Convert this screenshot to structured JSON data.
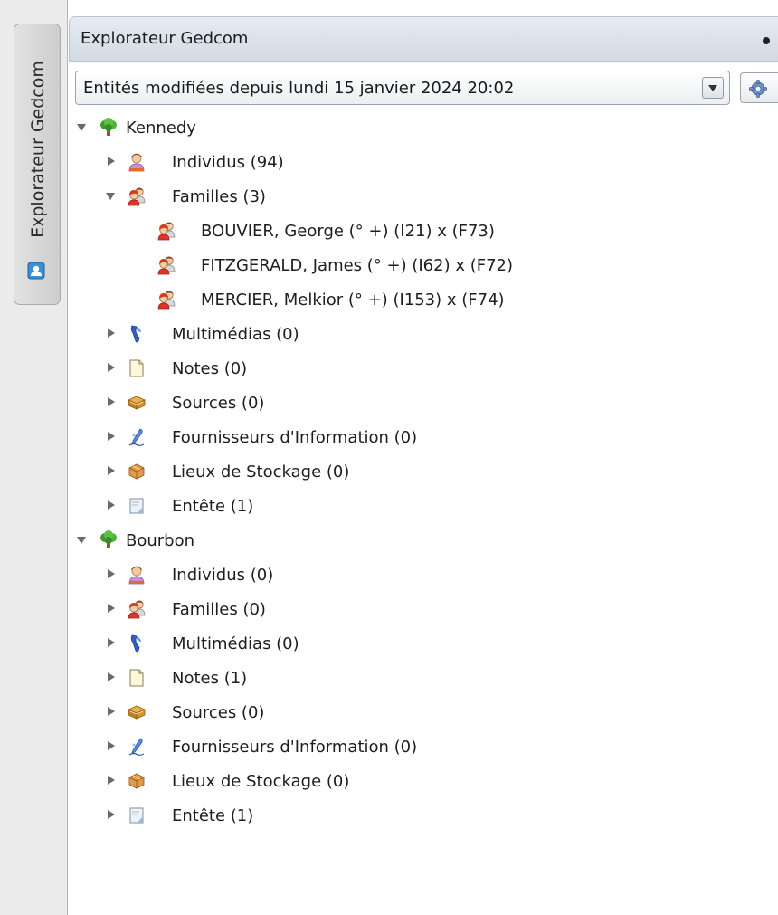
{
  "sidebar": {
    "tab_label": "Explorateur Gedcom",
    "tab_icon": "user-card-icon"
  },
  "panel": {
    "title": "Explorateur Gedcom"
  },
  "filter": {
    "selected": "Entités modifiées depuis lundi 15 janvier 2024 20:02",
    "settings_icon": "gear-icon"
  },
  "tree": {
    "kennedy": {
      "label": "Kennedy",
      "individus": "Individus (94)",
      "familles": "Familles (3)",
      "familles_items": [
        "BOUVIER, George (° +) (I21) x  (F73)",
        "FITZGERALD, James (° +) (I62) x  (F72)",
        "MERCIER, Melkior (° +) (I153) x  (F74)"
      ],
      "multimedias": "Multimédias (0)",
      "notes": "Notes (0)",
      "sources": "Sources (0)",
      "fournisseurs": "Fournisseurs d'Information (0)",
      "lieux": "Lieux de Stockage (0)",
      "entete": "Entête (1)"
    },
    "bourbon": {
      "label": "Bourbon",
      "individus": "Individus (0)",
      "familles": "Familles (0)",
      "multimedias": "Multimédias (0)",
      "notes": "Notes (1)",
      "sources": "Sources (0)",
      "fournisseurs": "Fournisseurs d'Information (0)",
      "lieux": "Lieux de Stockage (0)",
      "entete": "Entête (1)"
    }
  }
}
